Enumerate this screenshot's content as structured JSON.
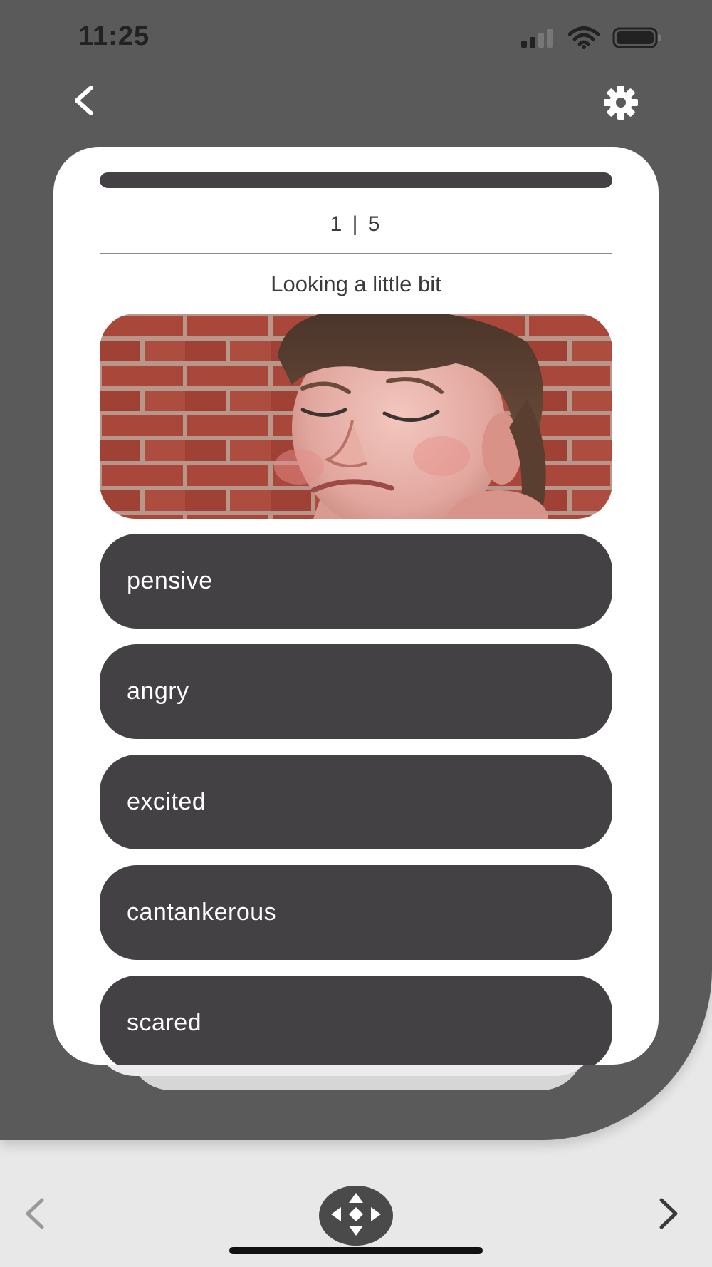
{
  "status_bar": {
    "time": "11:25",
    "icons": [
      "cellular-signal-icon",
      "wifi-icon",
      "battery-icon"
    ]
  },
  "header": {
    "back_icon": "chevron-left-icon",
    "settings_icon": "gear-icon"
  },
  "quiz": {
    "progress_fraction": 1.0,
    "counter": "1 | 5",
    "prompt": "Looking a little bit",
    "image_description_icon": "photo",
    "options": [
      {
        "label": "pensive"
      },
      {
        "label": "angry"
      },
      {
        "label": "excited"
      },
      {
        "label": "cantankerous"
      },
      {
        "label": "scared"
      }
    ]
  },
  "bottom_nav": {
    "prev_icon": "chevron-left-icon",
    "next_icon": "chevron-right-icon",
    "center_icon": "move-arrows-icon"
  },
  "colors": {
    "background_panel": "#5a5a5a",
    "card": "#ffffff",
    "option_button": "#434143",
    "option_text": "#ffffff",
    "page_bg": "#e8e8e8"
  }
}
